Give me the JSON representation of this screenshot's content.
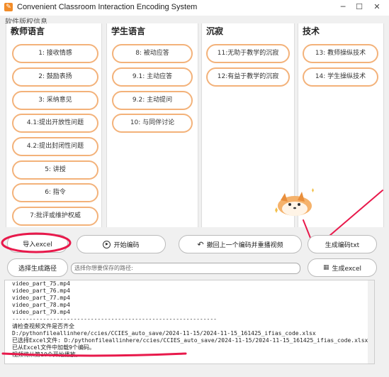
{
  "window": {
    "title": "Convenient Classroom Interaction Encoding System",
    "icon_glyph": "✎",
    "min": "─",
    "max": "☐",
    "close": "✕"
  },
  "menu": {
    "copyright": "软件版权信息"
  },
  "teacher": {
    "heading": "教师语言",
    "items": [
      "1: 接收情感",
      "2: 鼓励表扬",
      "3: 采纳意见",
      "4.1:提出开放性问题",
      "4.2:提出封闭性问题",
      "5: 讲授",
      "6: 指令",
      "7:批评或维护权威"
    ]
  },
  "student": {
    "heading": "学生语言",
    "items": [
      "8: 被动应答",
      "9.1: 主动应答",
      "9.2: 主动提问",
      "10: 与同伴讨论"
    ]
  },
  "silence": {
    "heading": "沉寂",
    "items": [
      "11:无助于教学的沉寂",
      "12:有益于教学的沉寂"
    ]
  },
  "tech": {
    "heading": "技术",
    "items": [
      "13: 教师操纵技术",
      "14: 学生操纵技术"
    ]
  },
  "actions": {
    "import_excel": "导入excel",
    "start_encoding": "开始编码",
    "undo_replay": "撤回上一个编码并重播视频",
    "generate_txt": "生成编码txt",
    "choose_path": "选择生成路径",
    "path_placeholder": "选择你想要保存的路径:",
    "generate_excel": "生成excel"
  },
  "console": {
    "lines": [
      "video_part_75.mp4",
      "video_part_76.mp4",
      "video_part_77.mp4",
      "video_part_78.mp4",
      "video_part_79.mp4",
      "------------------------------------------------------------",
      "请检查视频文件是否齐全",
      "",
      "D:/pythonfileallinhere/ccies/CCIES_auto_save/2024-11-15/2024-11-15_161425_ifias_code.xlsx",
      "已选择Excel文件: D:/pythonfileallinhere/ccies/CCIES_auto_save/2024-11-15/2024-11-15_161425_ifias_code.xlsx",
      "已从Excel文件中加载9个编码。",
      "视频将从第10个开始播放。"
    ]
  },
  "colors": {
    "pill_border": "#f3b27a",
    "annotation_red": "#e8194b"
  }
}
